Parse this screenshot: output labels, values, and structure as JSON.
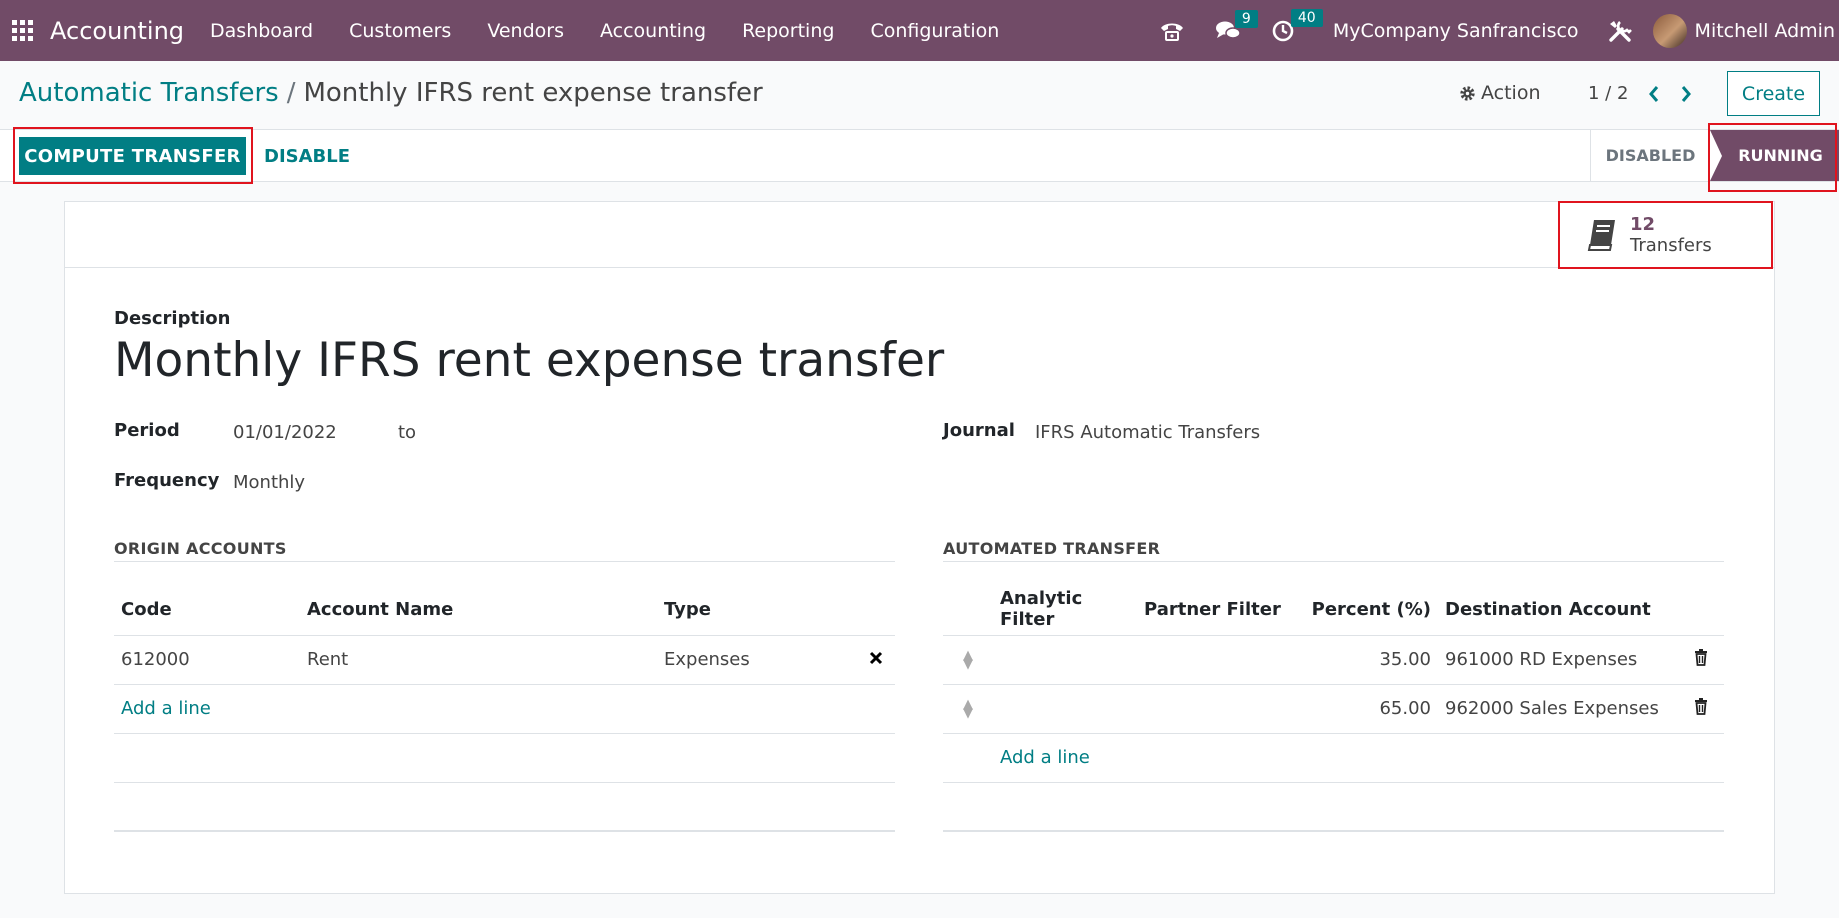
{
  "navbar": {
    "app_name": "Accounting",
    "menus": [
      "Dashboard",
      "Customers",
      "Vendors",
      "Accounting",
      "Reporting",
      "Configuration"
    ],
    "messages_count": "9",
    "activities_count": "40",
    "company": "MyCompany Sanfrancisco",
    "user": "Mitchell Admin"
  },
  "control_panel": {
    "breadcrumb_parent": "Automatic Transfers",
    "breadcrumb_separator": "/",
    "breadcrumb_current": "Monthly IFRS rent expense transfer",
    "action_label": "Action",
    "pager": "1 / 2",
    "create_label": "Create"
  },
  "statusbar": {
    "compute_label": "COMPUTE TRANSFER",
    "disable_label": "DISABLE",
    "stages": [
      "DISABLED",
      "RUNNING"
    ],
    "active_stage": "RUNNING"
  },
  "smart_button": {
    "value": "12",
    "label": "Transfers"
  },
  "form": {
    "description_label": "Description",
    "description": "Monthly IFRS rent expense transfer",
    "period_label": "Period",
    "period_from": "01/01/2022",
    "period_to_label": "to",
    "frequency_label": "Frequency",
    "frequency": "Monthly",
    "journal_label": "Journal",
    "journal": "IFRS Automatic Transfers"
  },
  "origin_accounts": {
    "title": "ORIGIN ACCOUNTS",
    "headers": [
      "Code",
      "Account Name",
      "Type"
    ],
    "rows": [
      {
        "code": "612000",
        "name": "Rent",
        "type": "Expenses"
      }
    ],
    "add_line": "Add a line"
  },
  "automated_transfer": {
    "title": "AUTOMATED TRANSFER",
    "headers": [
      "Analytic Filter",
      "Partner Filter",
      "Percent (%)",
      "Destination Account"
    ],
    "rows": [
      {
        "analytic": "",
        "partner": "",
        "percent": "35.00",
        "destination": "961000 RD Expenses"
      },
      {
        "analytic": "",
        "partner": "",
        "percent": "65.00",
        "destination": "962000 Sales Expenses"
      }
    ],
    "add_line": "Add a line"
  },
  "colors": {
    "brand": "#714b67",
    "accent": "#017e84",
    "highlight": "#e0141e"
  }
}
